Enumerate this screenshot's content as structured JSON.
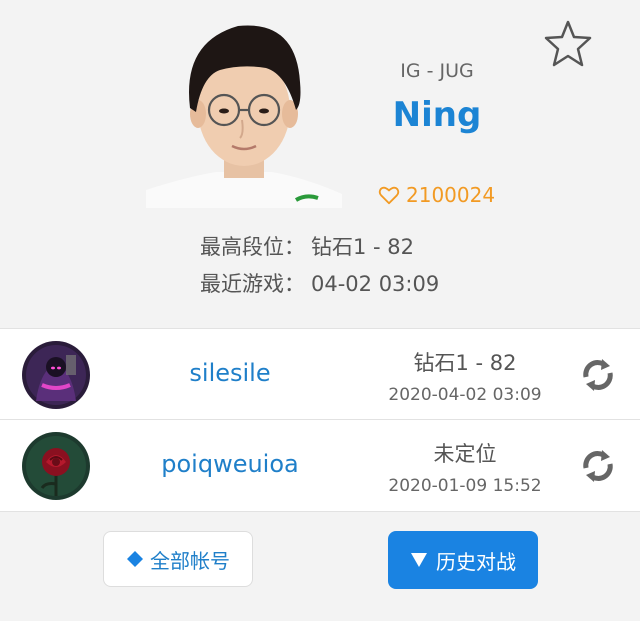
{
  "profile": {
    "team_role": "IG - JUG",
    "name": "Ning",
    "likes": "2100024",
    "highest_rank_label": "最高段位：",
    "highest_rank_value": "钻石1 - 82",
    "recent_game_label": "最近游戏：",
    "recent_game_value": "04-02 03:09",
    "icons": {
      "favorite": "star-outline-icon",
      "likes": "heart-outline-icon"
    }
  },
  "accounts": [
    {
      "name": "silesile",
      "rank": "钻石1 - 82",
      "date": "2020-04-02 03:09",
      "avatar": "purple-champion-avatar",
      "action_icon": "refresh-icon"
    },
    {
      "name": "poiqweuioa",
      "rank": "未定位",
      "date": "2020-01-09 15:52",
      "avatar": "rose-avatar",
      "action_icon": "refresh-icon"
    }
  ],
  "buttons": {
    "all_accounts": "全部帐号",
    "all_accounts_icon": "diamond-icon",
    "history": "历史对战",
    "history_icon": "triangle-down-icon"
  },
  "colors": {
    "accent_blue": "#1c84d4",
    "button_blue": "#1a83e2",
    "likes_orange": "#f29a23"
  }
}
